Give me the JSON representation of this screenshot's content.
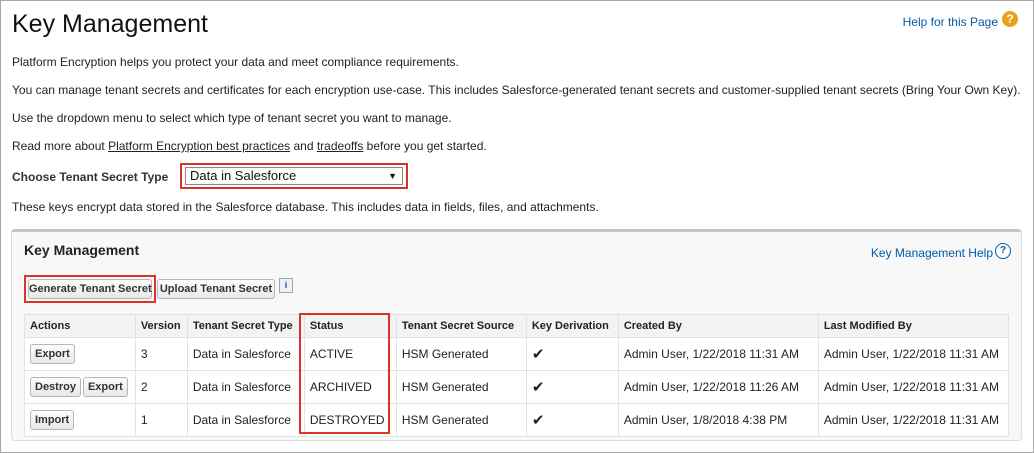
{
  "header": {
    "title": "Key Management",
    "help_link": "Help for this Page",
    "help_icon": "question-circle-icon"
  },
  "intro": {
    "p1": "Platform Encryption helps you protect your data and meet compliance requirements.",
    "p2": "You can manage tenant secrets and certificates for each encryption use-case. This includes Salesforce-generated tenant secrets and customer-supplied tenant secrets (Bring Your Own Key).",
    "p3": "Use the dropdown menu to select which type of tenant secret you want to manage.",
    "p4_prefix": "Read more about ",
    "p4_link1": "Platform Encryption best practices",
    "p4_mid": " and ",
    "p4_link2": "tradeoffs",
    "p4_suffix": " before you get started."
  },
  "chooser": {
    "label": "Choose Tenant Secret Type",
    "selected": "Data in Salesforce",
    "arrow": "▼"
  },
  "description": "These keys encrypt data stored in the Salesforce database. This includes data in fields, files, and attachments.",
  "panel": {
    "title": "Key Management",
    "help_link": "Key Management Help",
    "help_icon": "?",
    "generate_button": "Generate Tenant Secret",
    "upload_button": "Upload Tenant Secret",
    "info_icon": "i"
  },
  "table": {
    "headers": [
      "Actions",
      "Version",
      "Tenant Secret Type",
      "Status",
      "Tenant Secret Source",
      "Key Derivation",
      "Created By",
      "Last Modified By"
    ],
    "rows": [
      {
        "actions": [
          "Export"
        ],
        "version": "3",
        "type": "Data in Salesforce",
        "status": "ACTIVE",
        "source": "HSM Generated",
        "derivation": "✔",
        "created_by": "Admin User, 1/22/2018 11:31 AM",
        "modified_by": "Admin User, 1/22/2018 11:31 AM"
      },
      {
        "actions": [
          "Destroy",
          "Export"
        ],
        "version": "2",
        "type": "Data in Salesforce",
        "status": "ARCHIVED",
        "source": "HSM Generated",
        "derivation": "✔",
        "created_by": "Admin User, 1/22/2018 11:26 AM",
        "modified_by": "Admin User, 1/22/2018 11:31 AM"
      },
      {
        "actions": [
          "Import"
        ],
        "version": "1",
        "type": "Data in Salesforce",
        "status": "DESTROYED",
        "source": "HSM Generated",
        "derivation": "✔",
        "created_by": "Admin User, 1/8/2018 4:38 PM",
        "modified_by": "Admin User, 1/22/2018 11:31 AM"
      }
    ]
  },
  "colors": {
    "highlight": "#d9342b",
    "link": "#015ba7",
    "help_icon": "#e8a21a"
  }
}
